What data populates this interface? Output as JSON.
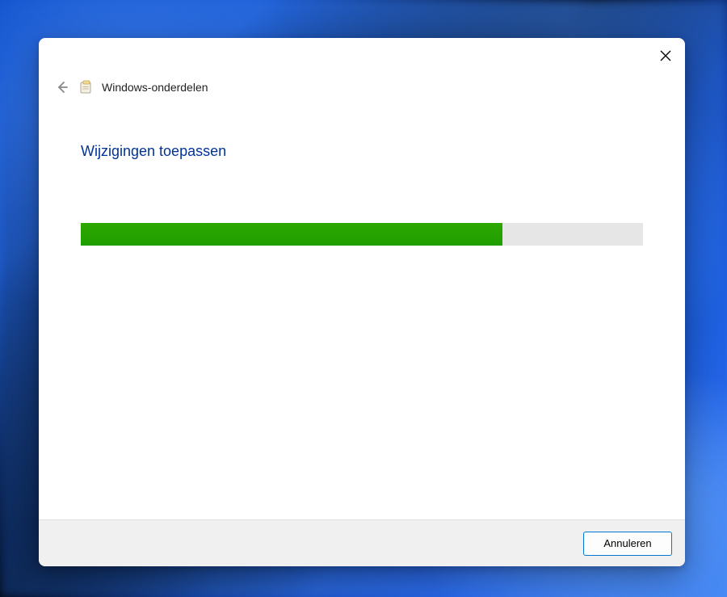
{
  "dialog": {
    "title": "Windows-onderdelen",
    "heading": "Wijzigingen toepassen",
    "progress_percent": 75,
    "progress_color": "#26a300",
    "cancel_label": "Annuleren"
  }
}
